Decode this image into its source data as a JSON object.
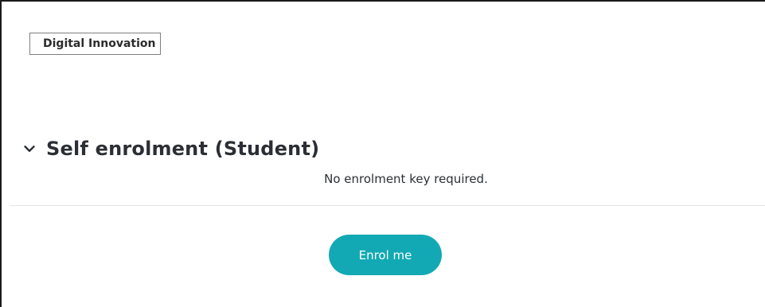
{
  "course": {
    "category_tag": "Digital Innovation"
  },
  "enrolment": {
    "section_title": "Self enrolment (Student)",
    "chevron_icon": "chevron-down-icon",
    "notice": "No enrolment key required.",
    "enrol_button_label": "Enrol me"
  },
  "colors": {
    "accent": "#12a9b4",
    "text": "#2b2f35",
    "divider": "#e3e4e6"
  }
}
